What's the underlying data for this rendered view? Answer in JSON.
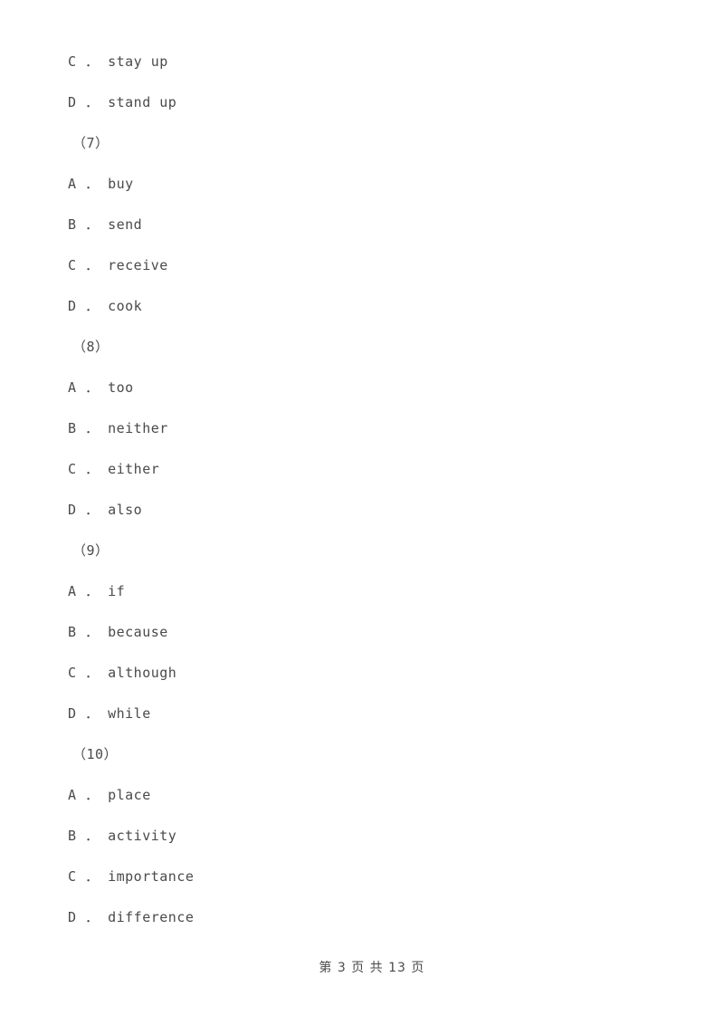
{
  "page": {
    "background_color": "#ffffff",
    "text_color": "#4a4a4a"
  },
  "body_lines": [
    {
      "kind": "option",
      "text": "C ． stay up"
    },
    {
      "kind": "option",
      "text": "D ． stand up"
    },
    {
      "kind": "q-number",
      "text": "（7）"
    },
    {
      "kind": "option",
      "text": "A ． buy"
    },
    {
      "kind": "option",
      "text": "B ． send"
    },
    {
      "kind": "option",
      "text": "C ． receive"
    },
    {
      "kind": "option",
      "text": "D ． cook"
    },
    {
      "kind": "q-number",
      "text": "（8）"
    },
    {
      "kind": "option",
      "text": "A ． too"
    },
    {
      "kind": "option",
      "text": "B ． neither"
    },
    {
      "kind": "option",
      "text": "C ． either"
    },
    {
      "kind": "option",
      "text": "D ． also"
    },
    {
      "kind": "q-number",
      "text": "（9）"
    },
    {
      "kind": "option",
      "text": "A ． if"
    },
    {
      "kind": "option",
      "text": "B ． because"
    },
    {
      "kind": "option",
      "text": "C ． although"
    },
    {
      "kind": "option",
      "text": "D ． while"
    },
    {
      "kind": "q-number",
      "text": "（10）"
    },
    {
      "kind": "option",
      "text": "A ． place"
    },
    {
      "kind": "option",
      "text": "B ． activity"
    },
    {
      "kind": "option",
      "text": "C ． importance"
    },
    {
      "kind": "option",
      "text": "D ． difference"
    }
  ],
  "footer": {
    "text": "第 3 页 共 13 页",
    "current_page": "3",
    "total_pages": "13"
  }
}
